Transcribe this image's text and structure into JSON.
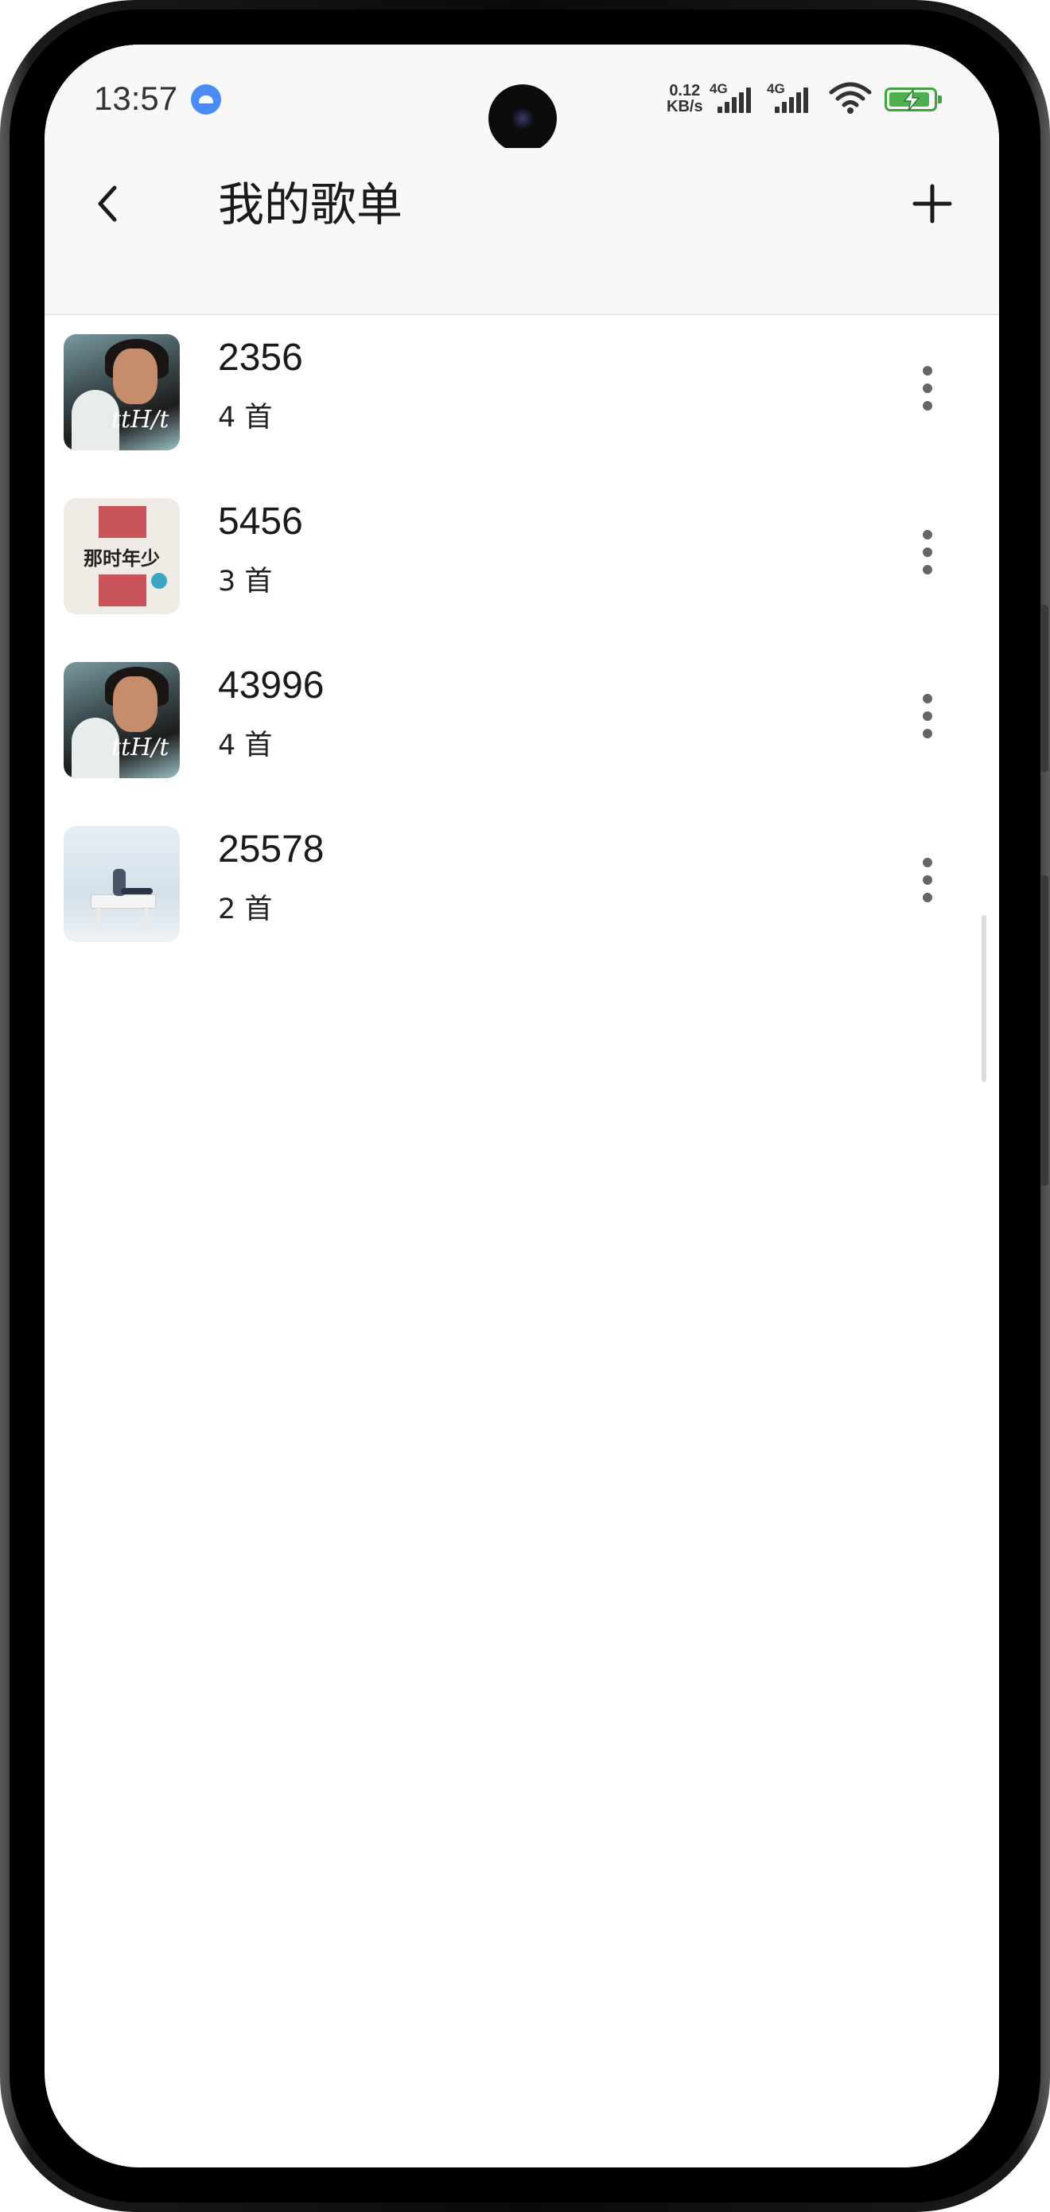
{
  "status_bar": {
    "time": "13:57",
    "net_speed_value": "0.12",
    "net_speed_unit": "KB/s",
    "signal_1_label": "4G",
    "signal_2_label": "4G",
    "notification_icon": "android-app-icon",
    "wifi_icon": "wifi-icon",
    "battery_icon": "battery-charging-icon",
    "battery_color": "#4caf50"
  },
  "toolbar": {
    "back_icon": "chevron-left-icon",
    "title": "我的歌单",
    "add_icon": "plus-icon"
  },
  "playlists": [
    {
      "name": "2356",
      "count": "4 首",
      "cover": "album-cover-singer-portrait"
    },
    {
      "name": "5456",
      "count": "3 首",
      "cover": "album-cover-na-shi-nian-shao",
      "cover_text": "那时年少"
    },
    {
      "name": "43996",
      "count": "4 首",
      "cover": "album-cover-singer-portrait"
    },
    {
      "name": "25578",
      "count": "2 首",
      "cover": "album-cover-piano"
    }
  ]
}
